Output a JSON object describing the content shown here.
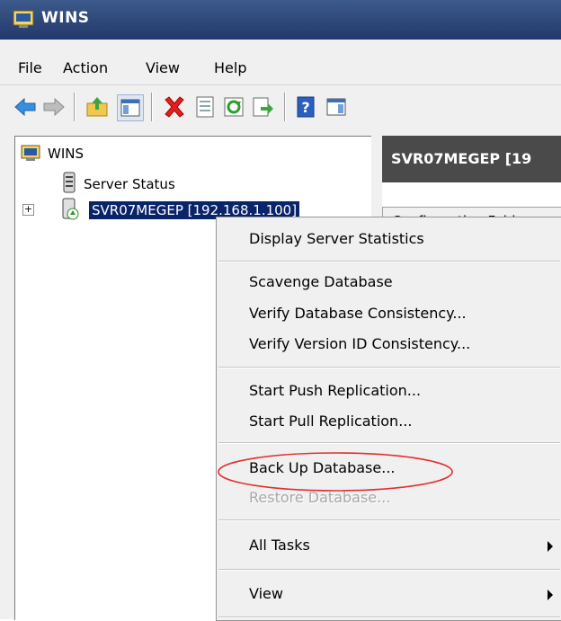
{
  "window": {
    "title": "WINS"
  },
  "menubar": {
    "items": [
      "File",
      "Action",
      "View",
      "Help"
    ]
  },
  "toolbar": {
    "buttons": [
      "back-icon",
      "forward-icon",
      "up-folder-icon",
      "show-hide-tree-icon",
      "delete-icon",
      "properties-icon",
      "refresh-icon",
      "export-list-icon",
      "help-icon",
      "show-action-pane-icon"
    ]
  },
  "tree": {
    "root": "WINS",
    "items": [
      {
        "label": "Server Status"
      },
      {
        "label": "SVR07MEGEP [192.168.1.100]",
        "expander": "+"
      }
    ]
  },
  "right_pane": {
    "header": "SVR07MEGEP [19",
    "column": "Configuration Folde"
  },
  "context_menu": {
    "items": [
      {
        "label": "Display Server Statistics",
        "enabled": true
      },
      {
        "label": "Scavenge Database",
        "enabled": true
      },
      {
        "label": "Verify Database Consistency...",
        "enabled": true
      },
      {
        "label": "Verify Version ID Consistency...",
        "enabled": true
      },
      {
        "label": "Start Push Replication...",
        "enabled": true
      },
      {
        "label": "Start Pull Replication...",
        "enabled": true
      },
      {
        "label": "Back Up Database...",
        "enabled": true,
        "highlighted": true
      },
      {
        "label": "Restore Database...",
        "enabled": false
      },
      {
        "label": "All Tasks",
        "enabled": true,
        "submenu": true
      },
      {
        "label": "View",
        "enabled": true,
        "submenu": true
      }
    ]
  },
  "colors": {
    "titlebar": "#22386a",
    "selection": "#0a246a",
    "annotation": "#e03030"
  }
}
